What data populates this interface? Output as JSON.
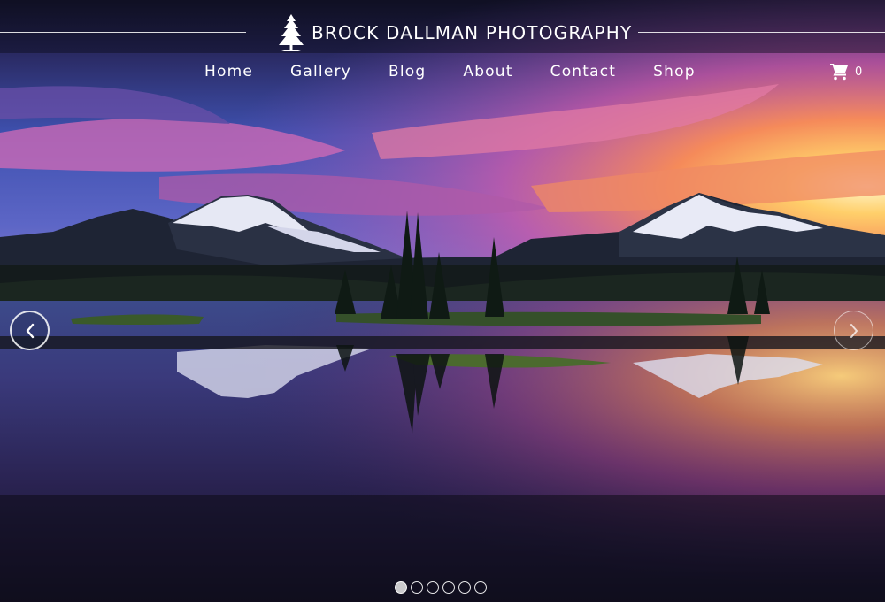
{
  "site": {
    "brand_name": "BROCK DALLMAN PHOTOGRAPHY",
    "logo_icon": "pine-tree-icon"
  },
  "nav": {
    "items": [
      {
        "label": "Home"
      },
      {
        "label": "Gallery"
      },
      {
        "label": "Blog"
      },
      {
        "label": "About"
      },
      {
        "label": "Contact"
      },
      {
        "label": "Shop"
      }
    ]
  },
  "cart": {
    "icon": "shopping-cart-icon",
    "count": "0"
  },
  "slider": {
    "prev_icon": "chevron-left-icon",
    "next_icon": "chevron-right-icon",
    "slide_count": 6,
    "active_index": 0
  },
  "colors": {
    "text": "#ffffff",
    "sky_top": "#1c1a3a",
    "sky_magenta": "#c45aa8",
    "sunset_orange": "#f4a24a",
    "mountain": "#202633",
    "water": "#1a1a33"
  }
}
